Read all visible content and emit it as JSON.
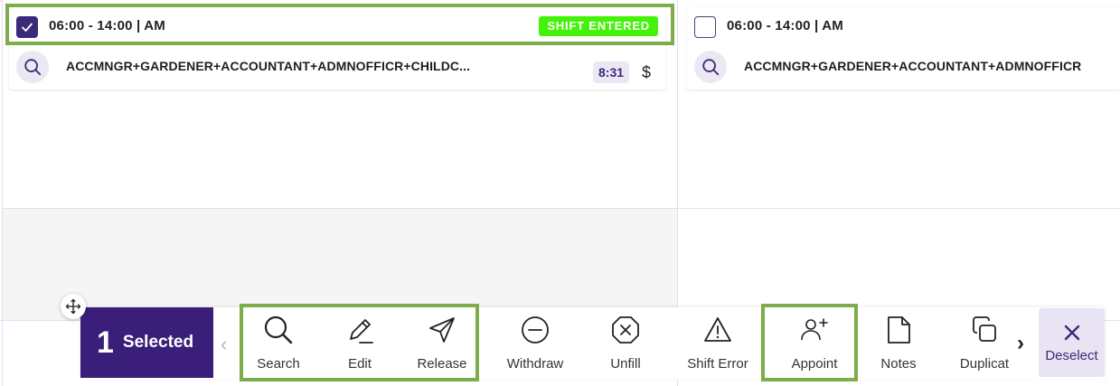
{
  "shifts": [
    {
      "checked": true,
      "time": "06:00 - 14:00 | AM",
      "status": "SHIFT ENTERED",
      "roles": "ACCMNGR+GARDENER+ACCOUNTANT+ADMNOFFICR+CHILDC...",
      "duration": "8:31",
      "currency_symbol": "$"
    },
    {
      "checked": false,
      "time": "06:00 - 14:00 | AM",
      "roles": "ACCMNGR+GARDENER+ACCOUNTANT+ADMNOFFICR"
    }
  ],
  "selection": {
    "count": "1",
    "label": "Selected"
  },
  "actions": {
    "search": "Search",
    "edit": "Edit",
    "release": "Release",
    "withdraw": "Withdraw",
    "unfill": "Unfill",
    "shift_error": "Shift Error",
    "appoint": "Appoint",
    "notes": "Notes",
    "duplicate": "Duplicat",
    "deselect": "Deselect"
  },
  "colors": {
    "brand": "#3b1e7a",
    "status_green": "#44f20a",
    "highlight": "#7dad4a"
  },
  "icons": [
    "check-icon",
    "search-icon",
    "pencil-icon",
    "send-icon",
    "minus-circle-icon",
    "x-octagon-icon",
    "warning-triangle-icon",
    "user-plus-icon",
    "note-icon",
    "copy-icon",
    "chevron-left-icon",
    "chevron-right-icon",
    "close-icon",
    "move-icon"
  ]
}
